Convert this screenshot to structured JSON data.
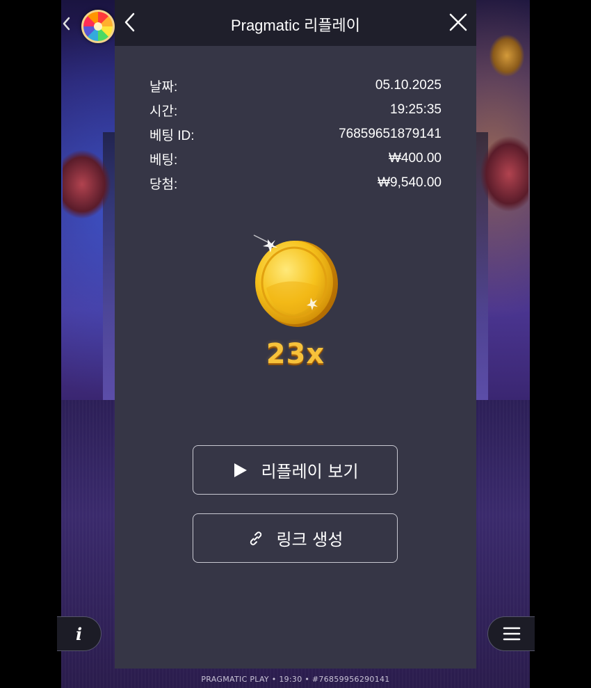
{
  "header": {
    "title": "Pragmatic 리플레이",
    "back_icon": "chevron-left-icon",
    "close_icon": "close-icon"
  },
  "outer": {
    "back_icon": "chevron-left-icon",
    "wheel_icon": "color-wheel-icon",
    "info_label": "i",
    "menu_icon": "hamburger-menu-icon",
    "ticker": "PRAGMATIC PLAY • 19:30 • #76859956290141"
  },
  "details": [
    {
      "label": "날짜:",
      "value": "05.10.2025"
    },
    {
      "label": "시간:",
      "value": "19:25:35"
    },
    {
      "label": "베팅 ID:",
      "value": "76859651879141"
    },
    {
      "label": "베팅:",
      "value": "₩400.00"
    },
    {
      "label": "당첨:",
      "value": "₩9,540.00"
    }
  ],
  "result": {
    "coin_icon": "gold-coin-icon",
    "multiplier": "23x"
  },
  "buttons": {
    "replay_label": "리플레이 보기",
    "replay_icon": "play-icon",
    "link_label": "링크 생성",
    "link_icon": "link-icon"
  },
  "colors": {
    "panel_bg": "#363646",
    "header_bg": "#1f1f2b",
    "multiplier_gold": "#f7c23a"
  }
}
